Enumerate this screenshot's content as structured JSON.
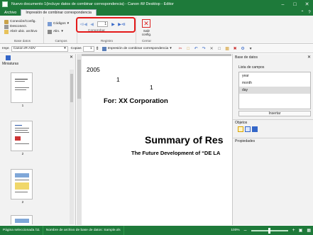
{
  "window": {
    "title": "Nuevo documento 1(incluye datos de combinar correspondencia) - Canon iW Desktop - Editor",
    "help_icon": "help-icon"
  },
  "tabs": [
    {
      "label": "Archivo"
    },
    {
      "label": "Impresión de combinar correspondencia"
    }
  ],
  "ribbon": {
    "base_datos": {
      "label": "Base datos",
      "items": [
        "Conexión/Config.",
        "Desconect.",
        "Abrir ubic. archivo"
      ]
    },
    "campos": {
      "label": "Campos",
      "codes": "Códigos",
      "alin": "Alin."
    },
    "registro": {
      "label": "Registro",
      "record_value": "1",
      "comprobar": "Comprobar"
    },
    "cerrar": {
      "label": "Cerrar",
      "salir": "Salir",
      "config": "config."
    }
  },
  "toolbar2": {
    "printer_label": "Impr.",
    "printer_value": "Canon iR-ADV",
    "copies_label": "Copias",
    "copies_value": "1",
    "print_label": "Impresión de combinar correspondencia"
  },
  "left_panel": {
    "title": "Miniaturas",
    "pages": [
      "1",
      "2",
      "2"
    ]
  },
  "document": {
    "year": "2005",
    "num1": "1",
    "num2": "1",
    "for_line": "For: XX Corporation",
    "heading": "Summary of Res",
    "subheading": "The Future Development of “DE LA"
  },
  "right_panel": {
    "section": "Base de datos",
    "list_label": "Lista de campos",
    "fields": [
      "year",
      "month",
      "day"
    ],
    "selected_field": "day",
    "insert": "Insertar",
    "objects_label": "Objetos",
    "properties_label": "Propiedades"
  },
  "status": {
    "selected_page": "Página seleccionada /11",
    "db_file": "Nombre de archivo de base de datos: Sample.xls",
    "zoom": "100%"
  },
  "colors": {
    "brand_green": "#1e7a3a",
    "highlight_red": "#e41a1a",
    "nav_blue": "#3466c8"
  }
}
